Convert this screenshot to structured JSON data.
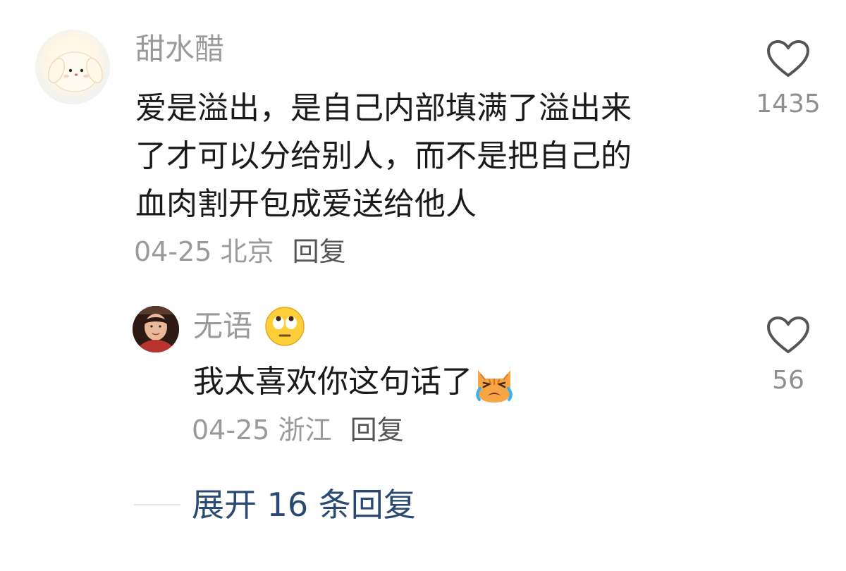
{
  "comment": {
    "avatar_icon": "puppy-avatar-icon",
    "username": "甜水醋",
    "content_lines": [
      "爱是溢出，是自己内部填满了溢出来",
      "了才可以分给别人，而不是把自己的",
      "血肉割开包成爱送给他人"
    ],
    "date": "04-25",
    "location": "北京",
    "reply_label": "回复",
    "like_icon": "heart-outline-icon",
    "like_count": "1435"
  },
  "reply": {
    "avatar_icon": "user-photo-avatar",
    "username": "无语",
    "username_emoji": "eye-roll-emoji-icon",
    "content": "我太喜欢你这句话了",
    "content_emoji": "crying-cat-emoji-icon",
    "date": "04-25",
    "location": "浙江",
    "reply_label": "回复",
    "like_icon": "heart-outline-icon",
    "like_count": "56"
  },
  "expand": {
    "label": "展开 16 条回复"
  },
  "colors": {
    "username": "#9a9a9a",
    "content": "#1a1a1a",
    "meta": "#9a9a9a",
    "reply_link": "#555555",
    "expand_link": "#2b4a73",
    "heart_stroke": "#555555"
  }
}
